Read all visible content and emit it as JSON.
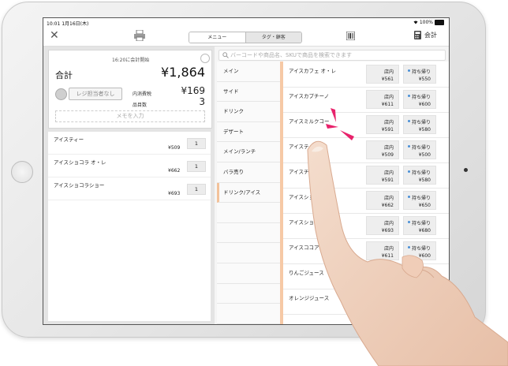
{
  "status": {
    "time": "10:01",
    "date": "1月16日(木)",
    "battery": "100%"
  },
  "toolbar": {
    "tab_menu": "メニュー",
    "tab_customer": "タグ・顧客",
    "register_label": "会計"
  },
  "order": {
    "start_time": "16:20に会計開始",
    "total_label": "合計",
    "total_amount": "¥1,864",
    "staff_label": "レジ担当者なし",
    "tax_label": "内消費税",
    "tax_value": "¥169",
    "item_count_label": "品目数",
    "item_count_value": "3",
    "memo_placeholder": "メモを入力",
    "items": [
      {
        "name": "アイスティー",
        "price": "¥509",
        "qty": "1"
      },
      {
        "name": "アイスショコラ オ・レ",
        "price": "¥662",
        "qty": "1"
      },
      {
        "name": "アイスショコラショー",
        "price": "¥693",
        "qty": "1"
      }
    ]
  },
  "search": {
    "placeholder": "バーコードや商品名、SKUで商品を検索できます"
  },
  "categories": [
    "メイン",
    "サイド",
    "ドリンク",
    "デザート",
    "メイン/ランチ",
    "バラ売り",
    "ドリンク/アイス",
    "",
    "",
    "",
    "",
    "",
    ""
  ],
  "active_category": "ドリンク/アイス",
  "products": [
    {
      "name": "アイスカフェ オ・レ",
      "in_label": "店内",
      "in_price": "¥561",
      "out_label": "持ち帰り",
      "out_price": "¥550"
    },
    {
      "name": "アイスカプチーノ",
      "in_label": "店内",
      "in_price": "¥611",
      "out_label": "持ち帰り",
      "out_price": "¥600"
    },
    {
      "name": "アイスミルクコー",
      "in_label": "店内",
      "in_price": "¥591",
      "out_label": "持ち帰り",
      "out_price": "¥580"
    },
    {
      "name": "アイステ",
      "in_label": "店内",
      "in_price": "¥509",
      "out_label": "持ち帰り",
      "out_price": "¥500"
    },
    {
      "name": "アイスチ",
      "in_label": "店内",
      "in_price": "¥591",
      "out_label": "持ち帰り",
      "out_price": "¥580"
    },
    {
      "name": "アイスショ",
      "in_label": "店内",
      "in_price": "¥662",
      "out_label": "持ち帰り",
      "out_price": "¥650"
    },
    {
      "name": "アイスショコ",
      "in_label": "店内",
      "in_price": "¥693",
      "out_label": "持ち帰り",
      "out_price": "¥680"
    },
    {
      "name": "アイスココア",
      "in_label": "店内",
      "in_price": "¥611",
      "out_label": "持ち帰り",
      "out_price": "¥600"
    },
    {
      "name": "りんごジュース",
      "in_label": "店内",
      "in_price": "¥",
      "out_label": "",
      "out_price": ""
    },
    {
      "name": "オレンジジュース",
      "in_label": "",
      "in_price": "",
      "out_label": "",
      "out_price": ""
    }
  ],
  "colors": {
    "accent": "#f6c9a6",
    "tap": "#e8226b",
    "dot": "#4a8fd6"
  }
}
